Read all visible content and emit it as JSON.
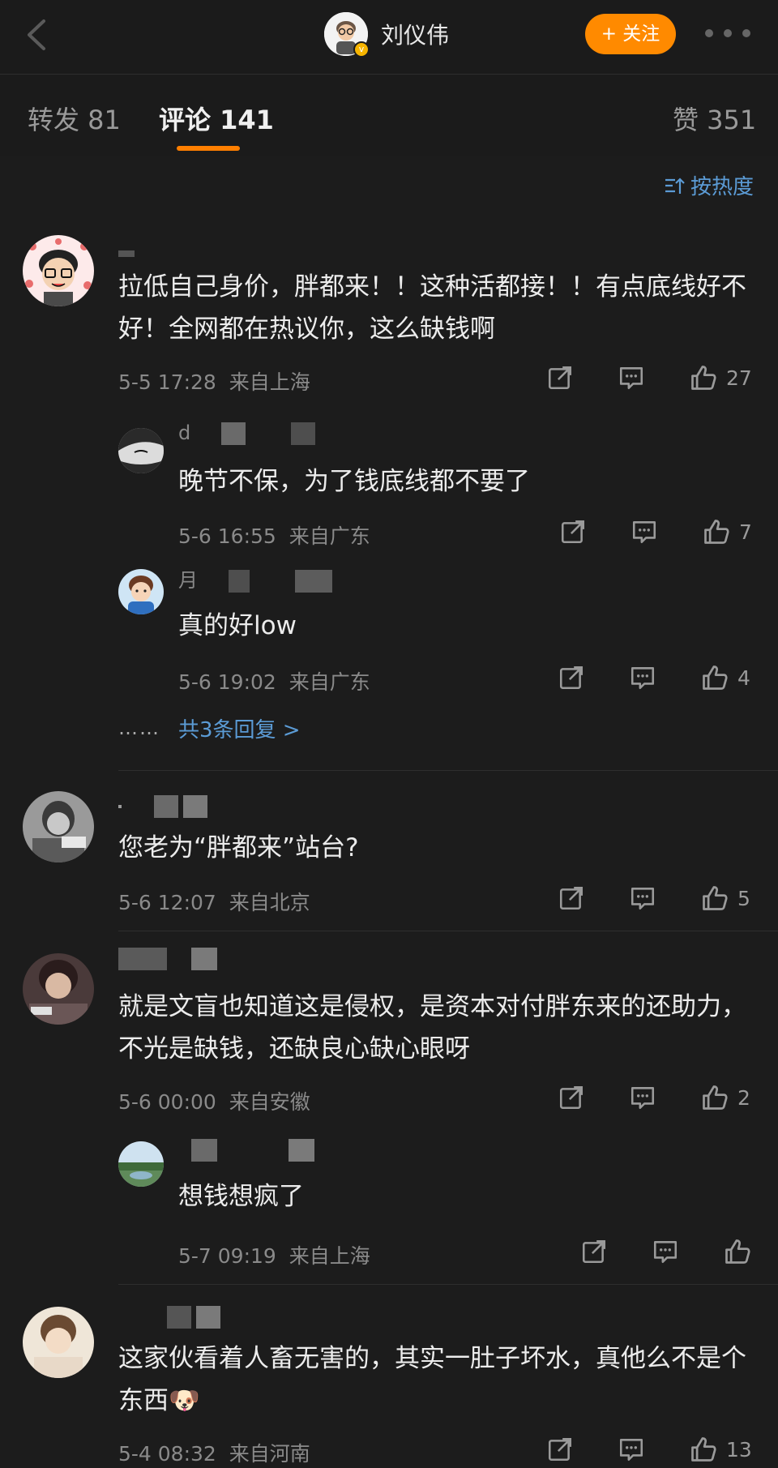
{
  "header": {
    "title": "刘仪伟",
    "follow_label": "+ 关注"
  },
  "tabs": [
    {
      "label": "转发 81"
    },
    {
      "label": "评论 141"
    },
    {
      "label": "赞 351"
    }
  ],
  "sort_label": "按热度",
  "comments": [
    {
      "text": "拉低自己身价，胖都来！！这种活都接！！有点底线好不好！全网都在热议你，这么缺钱啊",
      "time": "5-5 17:28",
      "location": "来自上海",
      "likes": "27",
      "replies": [
        {
          "name_prefix": "d",
          "text": "晚节不保，为了钱底线都不要了",
          "time": "5-6 16:55",
          "location": "来自广东",
          "likes": "7"
        },
        {
          "name_prefix": "月",
          "text": "真的好low",
          "time": "5-6 19:02",
          "location": "来自广东",
          "likes": "4"
        }
      ],
      "dots": "……",
      "more_replies": "共3条回复 >"
    },
    {
      "text": "您老为“胖都来”站台?",
      "time": "5-6 12:07",
      "location": "来自北京",
      "likes": "5"
    },
    {
      "text": "就是文盲也知道这是侵权，是资本对付胖东来的还助力，不光是缺钱，还缺良心缺心眼呀",
      "time": "5-6 00:00",
      "location": "来自安徽",
      "likes": "2",
      "replies": [
        {
          "text": "想钱想疯了",
          "time": "5-7 09:19",
          "location": "来自上海",
          "likes": ""
        }
      ]
    },
    {
      "text": "这家伙看着人畜无害的，其实一肚子坏水，真他么不是个东西🐶",
      "time": "5-4 08:32",
      "location": "来自河南",
      "likes": "13"
    }
  ]
}
